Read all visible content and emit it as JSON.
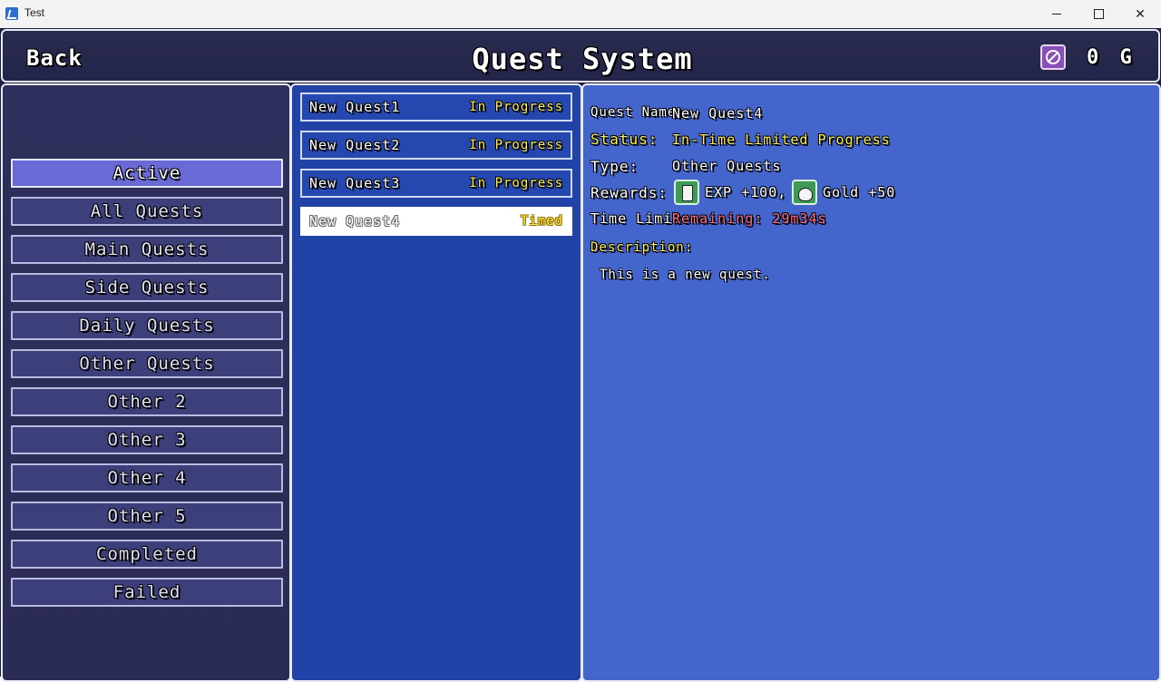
{
  "window": {
    "title": "Test",
    "minimize_icon": "minimize-icon",
    "maximize_icon": "maximize-icon",
    "close_glyph": "✕"
  },
  "header": {
    "back_label": "Back",
    "title": "Quest System",
    "gold_icon": "gold-coin-icon",
    "gold_amount": "0 G"
  },
  "categories": [
    {
      "label": "Active",
      "selected": true
    },
    {
      "label": "All Quests",
      "selected": false
    },
    {
      "label": "Main Quests",
      "selected": false
    },
    {
      "label": "Side Quests",
      "selected": false
    },
    {
      "label": "Daily Quests",
      "selected": false
    },
    {
      "label": "Other Quests",
      "selected": false
    },
    {
      "label": "Other 2",
      "selected": false
    },
    {
      "label": "Other 3",
      "selected": false
    },
    {
      "label": "Other 4",
      "selected": false
    },
    {
      "label": "Other 5",
      "selected": false
    },
    {
      "label": "Completed",
      "selected": false
    },
    {
      "label": "Failed",
      "selected": false
    }
  ],
  "quests": [
    {
      "name": "New Quest1",
      "status": "In Progress",
      "selected": false
    },
    {
      "name": "New Quest2",
      "status": "In Progress",
      "selected": false
    },
    {
      "name": "New Quest3",
      "status": "In Progress",
      "selected": false
    },
    {
      "name": "New Quest4",
      "status": "Timed",
      "selected": true
    }
  ],
  "detail": {
    "name_label": "Quest Name:",
    "name_value": "New Quest4",
    "status_label": "Status:",
    "status_value": "In-Time Limited Progress",
    "type_label": "Type:",
    "type_value": "Other Quests",
    "rewards_label": "Rewards:",
    "reward_exp_icon": "exp-book-icon",
    "reward_exp": "EXP +100,",
    "reward_gold_icon": "gold-bag-icon",
    "reward_gold": "Gold +50",
    "time_label": "Time Limit:",
    "time_value": "Remaining: 29m34s",
    "description_label": "Description:",
    "description_text": "This is a new quest."
  },
  "colors": {
    "accent_yellow": "#ffef5a",
    "timer_red": "#ff6b8a",
    "detail_bg": "#4466cc",
    "list_bg": "#2143a8",
    "category_selected": "#6a6ad6"
  }
}
